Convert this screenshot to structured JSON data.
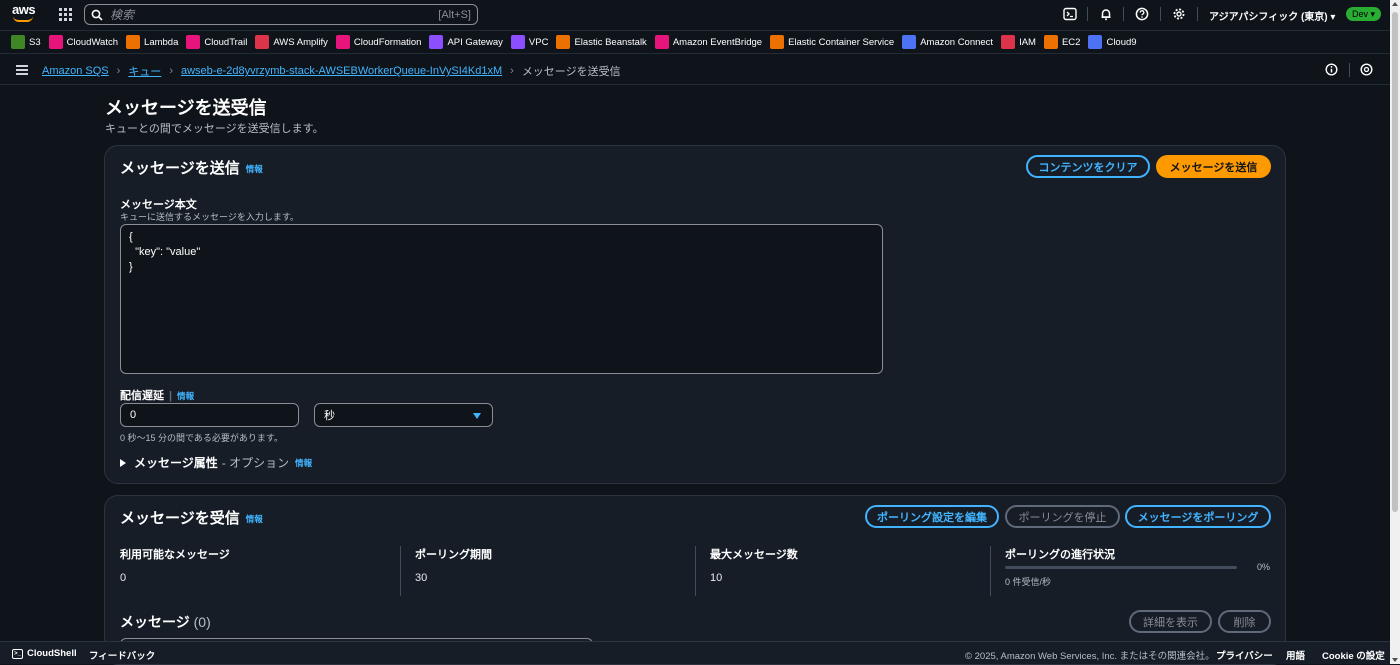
{
  "topnav": {
    "search_placeholder": "検索",
    "search_shortcut": "[Alt+S]",
    "region": "アジアパシフィック (東京) ▾",
    "account_badge": "Dev ▾",
    "logo_text": "aws"
  },
  "favorites": [
    {
      "label": "S3",
      "icon": "s3-icon",
      "color": "#3f8624"
    },
    {
      "label": "CloudWatch",
      "icon": "cloudwatch-icon",
      "color": "#e7157b"
    },
    {
      "label": "Lambda",
      "icon": "lambda-icon",
      "color": "#ed7100"
    },
    {
      "label": "CloudTrail",
      "icon": "cloudtrail-icon",
      "color": "#e7157b"
    },
    {
      "label": "AWS Amplify",
      "icon": "amplify-icon",
      "color": "#dd344c"
    },
    {
      "label": "CloudFormation",
      "icon": "cloudformation-icon",
      "color": "#e7157b"
    },
    {
      "label": "API Gateway",
      "icon": "apigateway-icon",
      "color": "#8c4fff"
    },
    {
      "label": "VPC",
      "icon": "vpc-icon",
      "color": "#8c4fff"
    },
    {
      "label": "Elastic Beanstalk",
      "icon": "beanstalk-icon",
      "color": "#ed7100"
    },
    {
      "label": "Amazon EventBridge",
      "icon": "eventbridge-icon",
      "color": "#e7157b"
    },
    {
      "label": "Elastic Container Service",
      "icon": "ecs-icon",
      "color": "#ed7100"
    },
    {
      "label": "Amazon Connect",
      "icon": "connect-icon",
      "color": "#4d72f3"
    },
    {
      "label": "IAM",
      "icon": "iam-icon",
      "color": "#dd344c"
    },
    {
      "label": "EC2",
      "icon": "ec2-icon",
      "color": "#ed7100"
    },
    {
      "label": "Cloud9",
      "icon": "cloud9-icon",
      "color": "#4d72f3"
    }
  ],
  "breadcrumb": {
    "items": [
      "Amazon SQS",
      "キュー",
      "awseb-e-2d8yvrzymb-stack-AWSEBWorkerQueue-InVySI4Kd1xM"
    ],
    "current": "メッセージを送受信"
  },
  "page": {
    "title": "メッセージを送受信",
    "description": "キューとの間でメッセージを送受信します。"
  },
  "send": {
    "title": "メッセージを送信",
    "info": "情報",
    "clear_button": "コンテンツをクリア",
    "send_button": "メッセージを送信",
    "body_label": "メッセージ本文",
    "body_desc": "キューに送信するメッセージを入力します。",
    "body_value": "{\n  \"key\": \"value\"\n}",
    "delay_label": "配信遅延",
    "delay_info": "情報",
    "delay_value": "0",
    "delay_unit": "秒",
    "delay_hint": "0 秒〜15 分の間である必要があります。",
    "attributes_label": "メッセージ属性",
    "attributes_optional": "- オプション",
    "attributes_info": "情報"
  },
  "receive": {
    "title": "メッセージを受信",
    "info": "情報",
    "edit_polling_button": "ポーリング設定を編集",
    "stop_polling_button": "ポーリングを停止",
    "poll_button": "メッセージをポーリング",
    "stats": {
      "available_label": "利用可能なメッセージ",
      "available_value": "0",
      "polling_duration_label": "ポーリング期間",
      "polling_duration_value": "30",
      "max_messages_label": "最大メッセージ数",
      "max_messages_value": "10",
      "progress_label": "ポーリングの進行状況",
      "progress_pct": "0%",
      "progress_fraction": 0,
      "progress_rate": "0 件受信/秒"
    },
    "messages_title": "メッセージ",
    "messages_count": "(0)",
    "details_button": "詳細を表示",
    "delete_button": "削除"
  },
  "footer": {
    "cloudshell": "CloudShell",
    "feedback": "フィードバック",
    "copyright": "© 2025, Amazon Web Services, Inc. またはその関連会社。",
    "privacy": "プライバシー",
    "terms": "用語",
    "cookie": "Cookie の設定"
  }
}
